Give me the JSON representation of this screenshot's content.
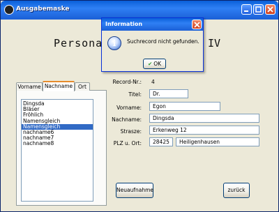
{
  "window": {
    "title": "Ausgabemaske"
  },
  "heading": {
    "left": "Personal",
    "right": "IV"
  },
  "tabs": [
    {
      "label": "Vorname",
      "active": false
    },
    {
      "label": "Nachname",
      "active": true
    },
    {
      "label": "Ort",
      "active": false
    }
  ],
  "list": {
    "items": [
      "Dingsda",
      "Bläser",
      "Fröhlich",
      "Namensgleich",
      "Namensgleich",
      "nachname6",
      "nachname7",
      "nachname8"
    ],
    "selected_index": 4
  },
  "form": {
    "record_label": "Record-Nr.:",
    "record_value": "4",
    "titel_label": "Titel:",
    "titel_value": "Dr.",
    "vorname_label": "Vorname:",
    "vorname_value": "Egon",
    "nachname_label": "Nachname:",
    "nachname_value": "Dingsda",
    "strasse_label": "Strasze:",
    "strasse_value": "Erkenweg 12",
    "plz_label": "PLZ u. Ort:",
    "plz_value": "28425",
    "ort_value": "Heiligenhausen"
  },
  "buttons": {
    "new": "Neuaufnahme",
    "back": "zurück"
  },
  "dialog": {
    "title": "Information",
    "message": "Suchrecord nicht gefunden.",
    "ok": "OK"
  }
}
